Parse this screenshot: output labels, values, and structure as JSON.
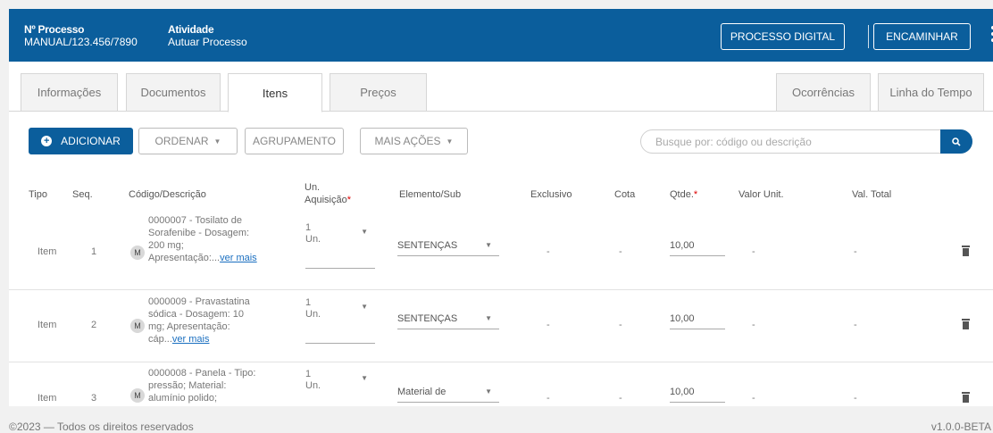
{
  "header": {
    "process_label": "Nº Processo",
    "process_value": "MANUAL/123.456/7890",
    "activity_label": "Atividade",
    "activity_value": "Autuar Processo",
    "btn_digital": "PROCESSO DIGITAL",
    "btn_forward": "ENCAMINHAR",
    "menu_icon": "kebab-menu-icon"
  },
  "tabs": {
    "left": [
      "Informações",
      "Documentos",
      "Itens",
      "Preços"
    ],
    "right": [
      "Ocorrências",
      "Linha do Tempo"
    ],
    "active": "Itens"
  },
  "toolbar": {
    "add": "ADICIONAR",
    "sort": "ORDENAR",
    "group": "AGRUPAMENTO",
    "more": "MAIS AÇÕES",
    "search_placeholder": "Busque por: código ou descrição",
    "search_icon": "search-icon"
  },
  "table": {
    "headers": {
      "tipo": "Tipo",
      "seq": "Seq.",
      "codigo": "Código/Descrição",
      "un1": "Un.",
      "un2": "Aquisição",
      "req": "*",
      "elemento": "Elemento/Sub",
      "exclusivo": "Exclusivo",
      "cota": "Cota",
      "qtde": "Qtde.",
      "valor_unit": "Valor Unit.",
      "val_total": "Val. Total"
    },
    "rows": [
      {
        "tipo": "Item",
        "seq": "1",
        "badge": "M",
        "desc": "0000007 - Tosilato de Sorafenibe - Dosagem: 200 mg; Apresentação:...",
        "more": "ver mais",
        "un": "1\nUn.",
        "elemento": "SENTENÇAS",
        "exclusivo": "-",
        "cota": "-",
        "qtde": "10,00",
        "valor_unit": "-",
        "val_total": "-"
      },
      {
        "tipo": "Item",
        "seq": "2",
        "badge": "M",
        "desc": "0000009 - Pravastatina sódica - Dosagem: 10 mg; Apresentação: cáp...",
        "more": "ver mais",
        "un": "1\nUn.",
        "elemento": "SENTENÇAS",
        "exclusivo": "-",
        "cota": "-",
        "qtde": "10,00",
        "valor_unit": "-",
        "val_total": "-"
      },
      {
        "tipo": "Item",
        "seq": "3",
        "badge": "M",
        "desc": "0000008 - Panela - Tipo: pressão; Material: alumínio polido;",
        "more": "",
        "un": "1\nUn.",
        "elemento": "Material de",
        "exclusivo": "-",
        "cota": "-",
        "qtde": "10,00",
        "valor_unit": "-",
        "val_total": "-"
      }
    ]
  },
  "footer": {
    "copyright": "©2023 — Todos os direitos reservados",
    "version": "v1.0.0-BETA"
  }
}
